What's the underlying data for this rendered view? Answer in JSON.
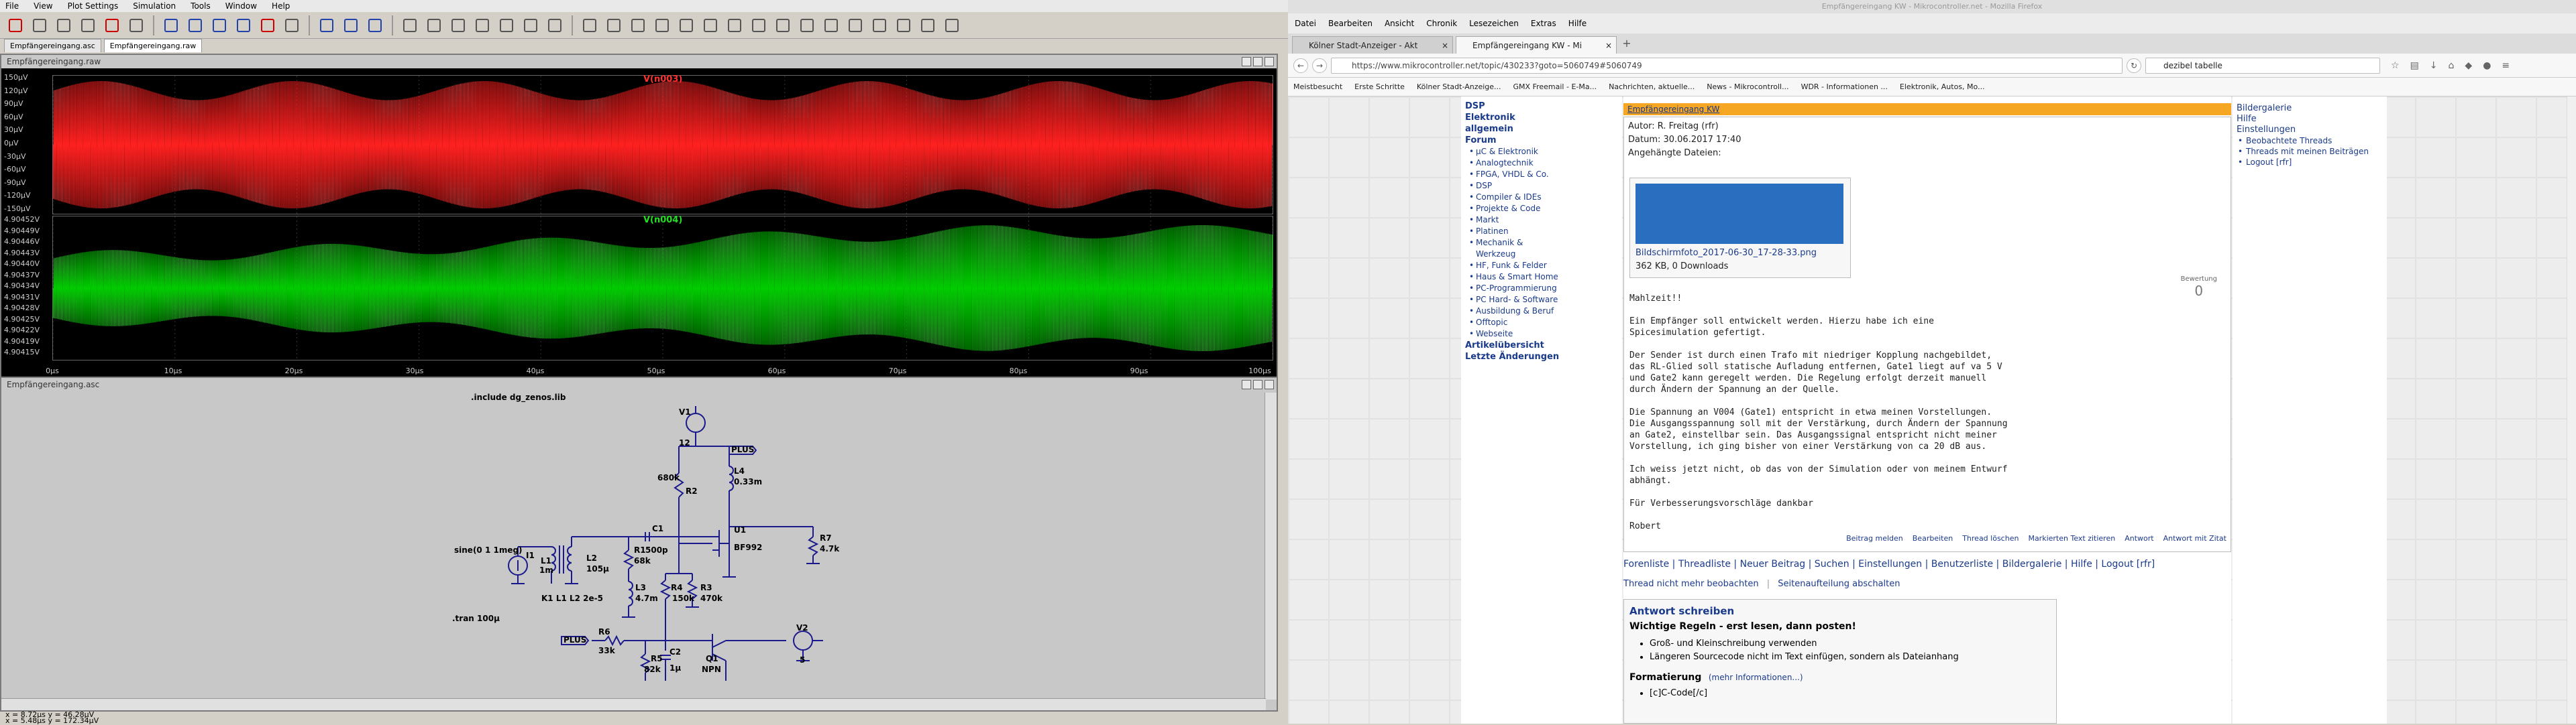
{
  "ltspice": {
    "menu": [
      "File",
      "View",
      "Plot Settings",
      "Simulation",
      "Tools",
      "Window",
      "Help"
    ],
    "tabs": [
      "Empfängereingang.asc",
      "Empfängereingang.raw"
    ],
    "plot_title": "Empfängereingang.raw",
    "schematic_title": "Empfängereingang.asc",
    "trace1": {
      "name": "V(n003)",
      "color": "#ff2020"
    },
    "trace2": {
      "name": "V(n004)",
      "color": "#00cc00"
    },
    "y1_ticks": [
      "150µV",
      "120µV",
      "90µV",
      "60µV",
      "30µV",
      "0µV",
      "-30µV",
      "-60µV",
      "-90µV",
      "-120µV",
      "-150µV"
    ],
    "y2_ticks": [
      "4.90452V",
      "4.90449V",
      "4.90446V",
      "4.90443V",
      "4.90440V",
      "4.90437V",
      "4.90434V",
      "4.90431V",
      "4.90428V",
      "4.90425V",
      "4.90422V",
      "4.90419V",
      "4.90415V"
    ],
    "x_ticks": [
      "0µs",
      "10µs",
      "20µs",
      "30µs",
      "40µs",
      "50µs",
      "60µs",
      "70µs",
      "80µs",
      "90µs",
      "100µs"
    ],
    "schematic": {
      "directive_include": ".include dg_zenos.lib",
      "directive_tran": ".tran 100µ",
      "directive_k": "K1 L1 L2 2e-5",
      "source": "sine(0 1 1meg)",
      "i1": "I1",
      "l1": "L1",
      "l1v": "1m",
      "l2": "L2",
      "l2v": "105µ",
      "v1": "V1",
      "v1v": "12",
      "r1": "R1",
      "r1v": "68k",
      "r2": "R2",
      "r2v": "680k",
      "r3": "R3",
      "r3v": "470k",
      "r4": "R4",
      "r4v": "150k",
      "r5": "R5",
      "r5v": "82k",
      "r6": "R6",
      "r6v": "33k",
      "r7": "R7",
      "r7v": "4.7k",
      "c1": "C1",
      "c1v": "500p",
      "c2": "C2",
      "c2v": "1µ",
      "l3": "L3",
      "l3v": "4.7m",
      "l4": "L4",
      "l4v": "0.33m",
      "u1": "U1",
      "u1v": "BF992",
      "q1": "Q1",
      "q1v": "NPN",
      "v2": "V2",
      "v2v": "5",
      "plus": "PLUS"
    },
    "status1": "x = 8.72µs    y = 46.28µV",
    "status2": "x = 5.48µs    y = 172.34µV"
  },
  "firefox": {
    "window_title": "Empfängereingang KW - Mikrocontroller.net - Mozilla Firefox",
    "menu": [
      "Datei",
      "Bearbeiten",
      "Ansicht",
      "Chronik",
      "Lesezeichen",
      "Extras",
      "Hilfe"
    ],
    "tabs": [
      "Kölner Stadt-Anzeiger - Akt",
      "Empfängereingang KW - Mi"
    ],
    "url": "https://www.mikrocontroller.net/topic/430233?goto=5060749#5060749",
    "search": "dezibel tabelle",
    "bookmarks": [
      "Meistbesucht",
      "Erste Schritte",
      "Kölner Stadt-Anzeige...",
      "GMX Freemail - E-Ma...",
      "Nachrichten, aktuelle...",
      "News - Mikrocontroll...",
      "WDR - Informationen ...",
      "Elektronik, Autos, Mo..."
    ],
    "sidenav": {
      "top": [
        "DSP",
        "Elektronik allgemein",
        "Forum"
      ],
      "items": [
        "µC & Elektronik",
        "Analogtechnik",
        "FPGA, VHDL & Co.",
        "DSP",
        "Compiler & IDEs",
        "Projekte & Code",
        "Markt",
        "Platinen",
        "Mechanik & Werkzeug",
        "HF, Funk & Felder",
        "Haus & Smart Home",
        "PC-Programmierung",
        "PC Hard- & Software",
        "Ausbildung & Beruf",
        "Offtopic",
        "Webseite"
      ],
      "bottom": [
        "Artikelübersicht",
        "Letzte Änderungen"
      ]
    },
    "thread": {
      "title": "Empfängereingang KW",
      "author": "Autor: R. Freitag (rfr)",
      "date": "Datum: 30.06.2017 17:40",
      "attachments_label": "Angehängte Dateien:",
      "file": "Bildschirmfoto_2017-06-30_17-28-33.png",
      "file_info": "362 KB, 0 Downloads",
      "rating_label": "Bewertung",
      "rating": "0",
      "body": "Mahlzeit!!\n\nEin Empfänger soll entwickelt werden. Hierzu habe ich eine\nSpicesimulation gefertigt.\n\nDer Sender ist durch einen Trafo mit niedriger Kopplung nachgebildet,\ndas RL-Glied soll statische Aufladung entfernen, Gate1 liegt auf va 5 V\nund Gate2 kann geregelt werden. Die Regelung erfolgt derzeit manuell\ndurch Ändern der Spannung an der Quelle.\n\nDie Spannung an V004 (Gate1) entspricht in etwa meinen Vorstellungen.\nDie Ausgangsspannung soll mit der Verstärkung, durch Ändern der Spannung\nan Gate2, einstellbar sein. Das Ausgangssignal entspricht nicht meiner\nVorstellung, ich ging bisher von einer Verstärkung von ca 20 dB aus.\n\nIch weiss jetzt nicht, ob das von der Simulation oder von meinem Entwurf\nabhängt.\n\nFür Verbesserungsvorschläge dankbar\n\nRobert",
      "actions": [
        "Beitrag melden",
        "Bearbeiten",
        "Thread löschen",
        "Markierten Text zitieren",
        "Antwort",
        "Antwort mit Zitat"
      ]
    },
    "forum_links": "Forenliste | Threadliste | Neuer Beitrag | Suchen | Einstellungen | Benutzerliste | Bildergalerie | Hilfe | Logout [rfr]",
    "thread_links": [
      "Thread nicht mehr beobachten",
      "Seitenaufteilung abschalten"
    ],
    "reply": {
      "heading": "Antwort schreiben",
      "rules": "Wichtige Regeln - erst lesen, dann posten!",
      "rule_items": [
        "Groß- und Kleinschreibung verwenden",
        "Längeren Sourcecode nicht im Text einfügen, sondern als Dateianhang"
      ],
      "format": "Formatierung",
      "more": "(mehr Informationen...)",
      "code": "[c]C-Code[/c]"
    },
    "rightcol": {
      "top": [
        "Bildergalerie",
        "Hilfe",
        "Einstellungen"
      ],
      "items": [
        "Beobachtete Threads",
        "Threads mit meinen Beiträgen",
        "Logout [rfr]"
      ]
    }
  }
}
